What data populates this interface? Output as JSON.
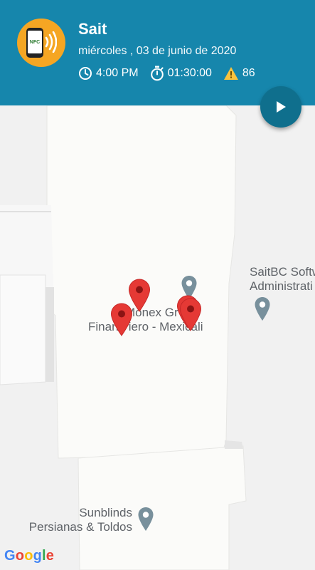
{
  "header": {
    "title": "Sait",
    "date": "miércoles , 03 de junio de 2020",
    "time": "4:00 PM",
    "duration": "01:30:00",
    "alert_count": "86",
    "avatar_label": "NFC",
    "colors": {
      "background": "#1686ac",
      "avatar": "#f5a623",
      "play_button": "#0f6f8d"
    }
  },
  "map": {
    "pois": [
      {
        "line1": "SaitBC Softw",
        "line2": "Administrati",
        "icon": "place-pin-icon"
      },
      {
        "line1": "Monex Gr",
        "line2": "Finan   iero - Mexicali",
        "icon": "place-pin-icon"
      },
      {
        "line1": "Sunblinds",
        "line2": "Persianas & Toldos",
        "icon": "place-pin-icon"
      }
    ],
    "markers": [
      "red-marker-icon",
      "red-marker-icon",
      "red-marker-icon",
      "red-marker-icon"
    ],
    "attribution": "Google",
    "colors": {
      "marker": "#e53935",
      "poi": "#78909c"
    }
  }
}
